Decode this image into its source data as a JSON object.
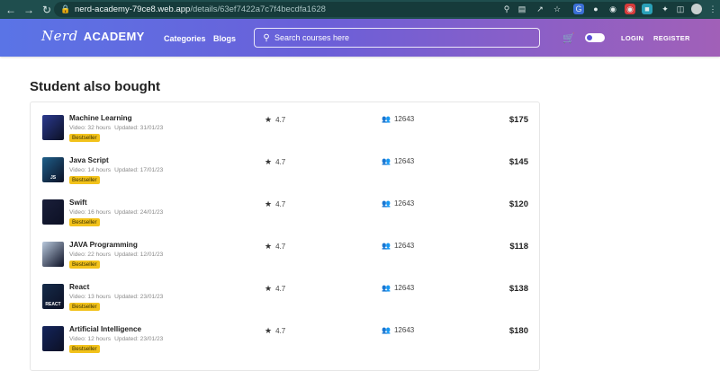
{
  "browser": {
    "url_host": "nerd-academy-79ce8.web.app",
    "url_path": "/details/63ef7422a7c7f4becdfa1628"
  },
  "header": {
    "logo_script": "Nerd",
    "logo_word": "ACADEMY",
    "nav": [
      "Categories",
      "Blogs"
    ],
    "search_placeholder": "Search courses here",
    "login": "LOGIN",
    "register": "REGISTER"
  },
  "section": {
    "title": "Student also bought"
  },
  "courses": [
    {
      "title": "Machine Learning",
      "video": "Video: 32 hours",
      "updated": "Updated: 31/01/23",
      "badge": "Bestseller",
      "rating": "4.7",
      "students": "12643",
      "price": "$175",
      "thumb_text": "",
      "thumb_color": "#2b3a8f"
    },
    {
      "title": "Java Script",
      "video": "Video: 14 hours",
      "updated": "Updated: 17/01/23",
      "badge": "Bestseller",
      "rating": "4.7",
      "students": "12643",
      "price": "$145",
      "thumb_text": "JS",
      "thumb_color": "#1f5f8a"
    },
    {
      "title": "Swift",
      "video": "Video: 16 hours",
      "updated": "Updated: 24/01/23",
      "badge": "Bestseller",
      "rating": "4.7",
      "students": "12643",
      "price": "$120",
      "thumb_text": "",
      "thumb_color": "#1a1f3a"
    },
    {
      "title": "JAVA Programming",
      "video": "Video: 22 hours",
      "updated": "Updated: 12/01/23",
      "badge": "Bestseller",
      "rating": "4.7",
      "students": "12643",
      "price": "$118",
      "thumb_text": "",
      "thumb_color": "#b8c8dc"
    },
    {
      "title": "React",
      "video": "Video: 13 hours",
      "updated": "Updated: 23/01/23",
      "badge": "Bestseller",
      "rating": "4.7",
      "students": "12643",
      "price": "$138",
      "thumb_text": "REACT",
      "thumb_color": "#152b4a"
    },
    {
      "title": "Artificial Intelligence",
      "video": "Video: 12 hours",
      "updated": "Updated: 23/01/23",
      "badge": "Bestseller",
      "rating": "4.7",
      "students": "12643",
      "price": "$180",
      "thumb_text": "",
      "thumb_color": "#14255c"
    }
  ]
}
